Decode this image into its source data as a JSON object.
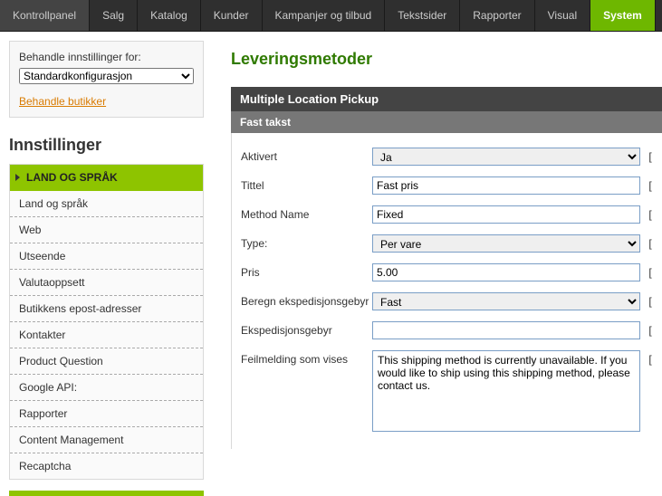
{
  "topnav": {
    "items": [
      {
        "label": "Kontrollpanel"
      },
      {
        "label": "Salg"
      },
      {
        "label": "Katalog"
      },
      {
        "label": "Kunder"
      },
      {
        "label": "Kampanjer og tilbud"
      },
      {
        "label": "Tekstsider"
      },
      {
        "label": "Rapporter"
      },
      {
        "label": "Visual"
      },
      {
        "label": "System",
        "active": true
      }
    ]
  },
  "sidebar": {
    "settings_for_label": "Behandle innstillinger for:",
    "settings_for_value": "Standardkonfigurasjon",
    "manage_stores_link": "Behandle butikker",
    "heading": "Innstillinger",
    "items": [
      {
        "label": "LAND OG SPRÅK",
        "active": true
      },
      {
        "label": "Land og språk"
      },
      {
        "label": "Web"
      },
      {
        "label": "Utseende"
      },
      {
        "label": "Valutaoppsett"
      },
      {
        "label": "Butikkens epost-adresser"
      },
      {
        "label": "Kontakter"
      },
      {
        "label": "Product Question"
      },
      {
        "label": "Google API:"
      },
      {
        "label": "Rapporter"
      },
      {
        "label": "Content Management"
      },
      {
        "label": "Recaptcha"
      }
    ]
  },
  "main": {
    "title": "Leveringsmetoder",
    "section_header": "Multiple Location Pickup",
    "section_sub": "Fast takst",
    "fields": {
      "aktivert": {
        "label": "Aktivert",
        "value": "Ja"
      },
      "tittel": {
        "label": "Tittel",
        "value": "Fast pris"
      },
      "method_name": {
        "label": "Method Name",
        "value": "Fixed"
      },
      "type": {
        "label": "Type:",
        "value": "Per vare"
      },
      "pris": {
        "label": "Pris",
        "value": "5.00"
      },
      "beregn": {
        "label": "Beregn ekspedisjonsgebyr",
        "value": "Fast"
      },
      "gebyr": {
        "label": "Ekspedisjonsgebyr",
        "value": ""
      },
      "feilmelding": {
        "label": "Feilmelding som vises",
        "value": "This shipping method is currently unavailable. If you would like to ship using this shipping method, please contact us."
      }
    }
  }
}
